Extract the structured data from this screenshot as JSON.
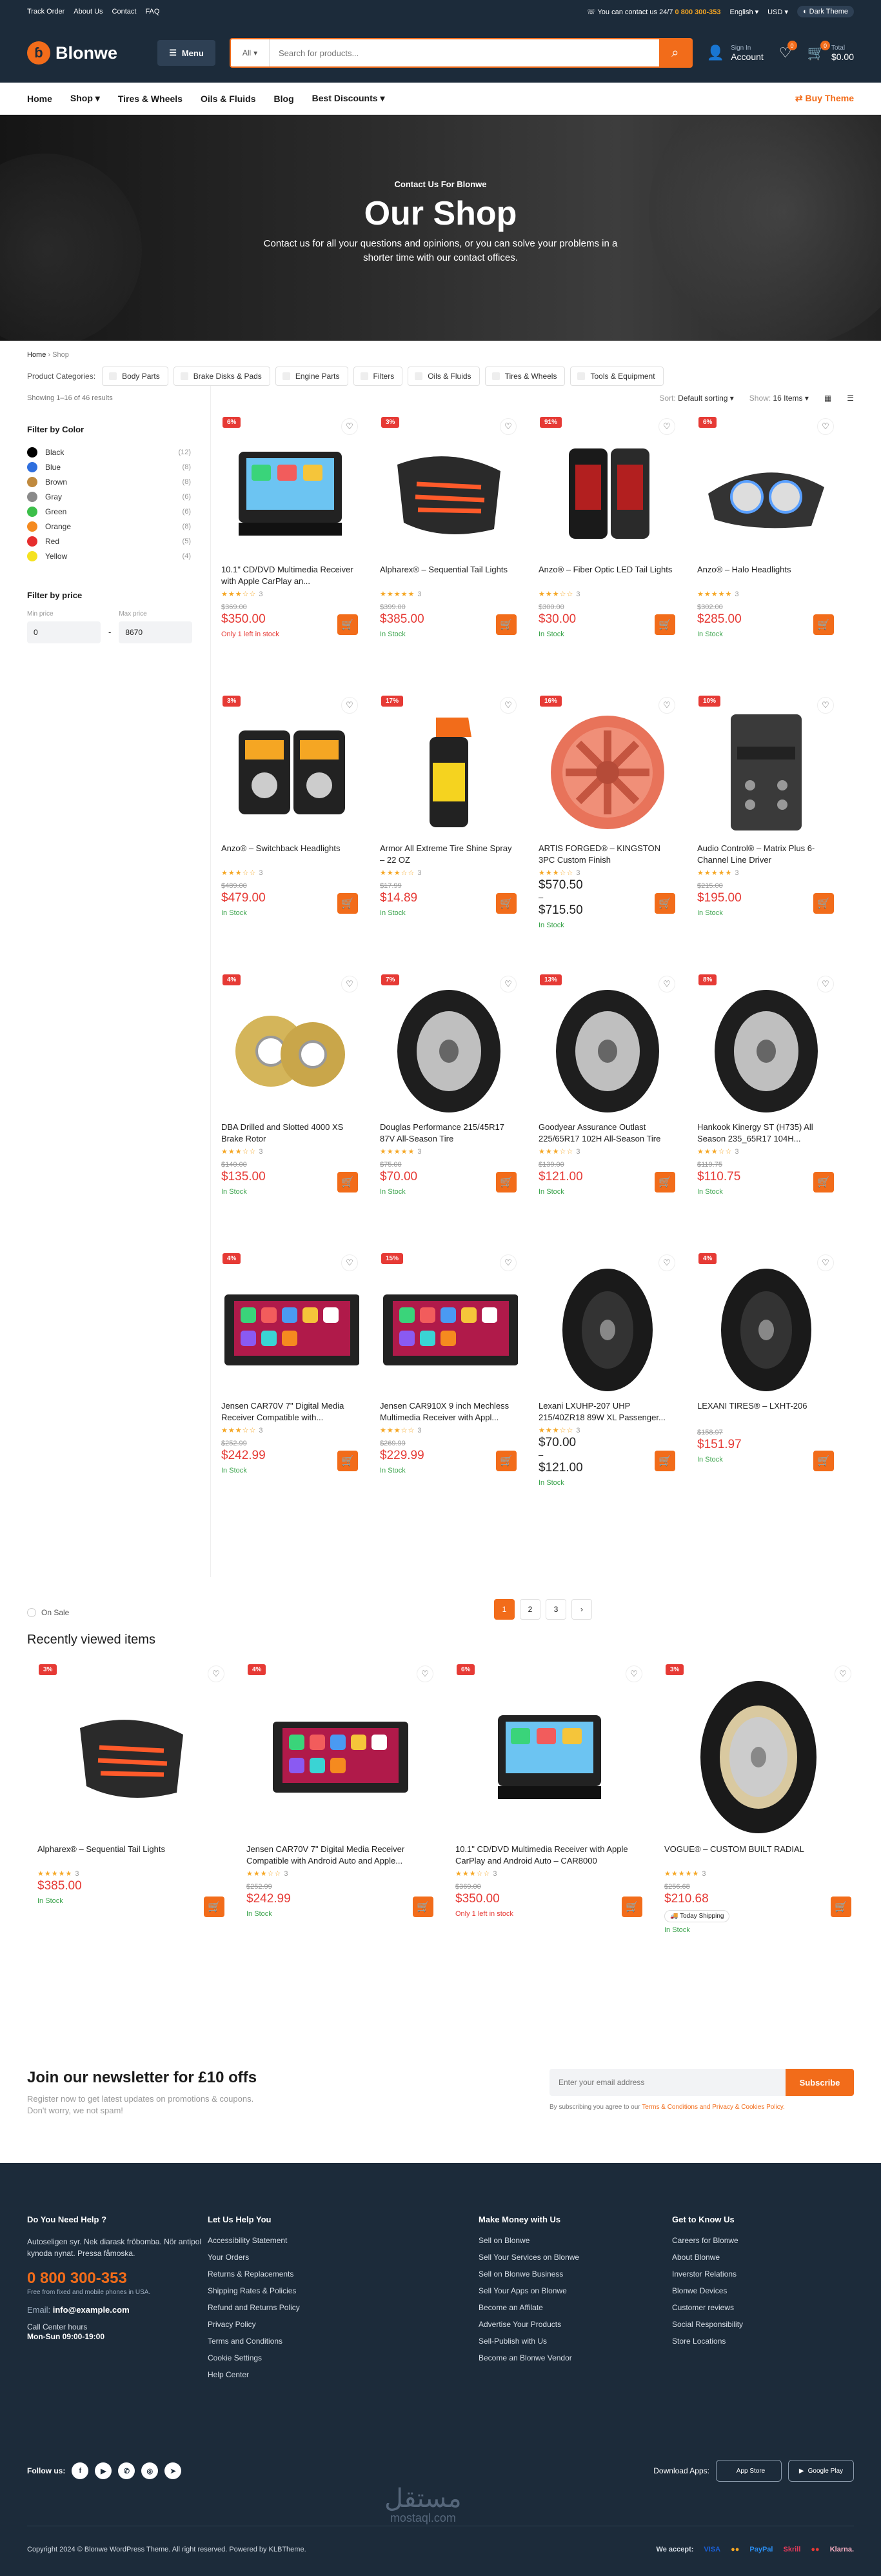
{
  "topbar": {
    "links": [
      "Track Order",
      "About Us",
      "Contact",
      "FAQ"
    ],
    "support": "You can contact us 24/7",
    "phone": "0 800 300-353",
    "lang": "English",
    "currency": "USD",
    "theme": "Dark Theme"
  },
  "header": {
    "logo": "Blonwe",
    "menu": "Menu",
    "search_cat": "All",
    "search_placeholder": "Search for products...",
    "signin": "Sign In",
    "account": "Account",
    "wish_count": "0",
    "cart_count": "0",
    "total_label": "Total",
    "total": "$0.00"
  },
  "nav": {
    "items": [
      "Home",
      "Shop",
      "Tires & Wheels",
      "Oils & Fluids",
      "Blog",
      "Best Discounts"
    ],
    "buy": "Buy Theme"
  },
  "hero": {
    "eyebrow": "Contact Us For Blonwe",
    "title": "Our Shop",
    "text": "Contact us for all your questions and opinions, or you can solve your problems in a shorter time with our contact offices."
  },
  "breadcrumb": {
    "home": "Home",
    "current": "Shop"
  },
  "categories": {
    "label": "Product Categories:",
    "items": [
      "Body Parts",
      "Brake Disks & Pads",
      "Engine Parts",
      "Filters",
      "Oils & Fluids",
      "Tires & Wheels",
      "Tools & Equipment"
    ]
  },
  "results": "Showing 1–16 of 46 results",
  "sort": {
    "label": "Sort:",
    "value": "Default sorting",
    "show_label": "Show:",
    "show_value": "16 Items"
  },
  "filters": {
    "color_title": "Filter by Color",
    "colors": [
      {
        "name": "Black",
        "count": "(12)",
        "hex": "#000000"
      },
      {
        "name": "Blue",
        "count": "(8)",
        "hex": "#2f6fde"
      },
      {
        "name": "Brown",
        "count": "(8)",
        "hex": "#c08a3e"
      },
      {
        "name": "Gray",
        "count": "(6)",
        "hex": "#8a8a8a"
      },
      {
        "name": "Green",
        "count": "(6)",
        "hex": "#3cbf4a"
      },
      {
        "name": "Orange",
        "count": "(8)",
        "hex": "#f58a1f"
      },
      {
        "name": "Red",
        "count": "(5)",
        "hex": "#e62e2e"
      },
      {
        "name": "Yellow",
        "count": "(4)",
        "hex": "#f5e21f"
      }
    ],
    "price_title": "Filter by price",
    "min_label": "Min price",
    "min": "0",
    "max_label": "Max price",
    "max": "8670"
  },
  "products": [
    {
      "disc": "6%",
      "title": "10.1\" CD/DVD Multimedia Receiver with Apple CarPlay an...",
      "stars": 3,
      "reviews": "3",
      "old": "$369.00",
      "price": "$350.00",
      "stock": "Only 1 left in stock",
      "low": true,
      "img": "stereo"
    },
    {
      "disc": "3%",
      "title": "Alpharex® – Sequential Tail Lights",
      "stars": 5,
      "reviews": "3",
      "old": "$399.00",
      "price": "$385.00",
      "stock": "In Stock",
      "img": "tail"
    },
    {
      "disc": "91%",
      "title": "Anzo® – Fiber Optic LED Tail Lights",
      "stars": 3,
      "reviews": "3",
      "old": "$300.00",
      "price": "$30.00",
      "stock": "In Stock",
      "img": "tail2"
    },
    {
      "disc": "6%",
      "title": "Anzo® – Halo Headlights",
      "stars": 5,
      "reviews": "3",
      "old": "$302.00",
      "price": "$285.00",
      "stock": "In Stock",
      "img": "head"
    },
    {
      "disc": "3%",
      "title": "Anzo® – Switchback Headlights",
      "stars": 3,
      "reviews": "3",
      "old": "$489.00",
      "price": "$479.00",
      "stock": "In Stock",
      "img": "head2"
    },
    {
      "disc": "17%",
      "title": "Armor All Extreme Tire Shine Spray – 22 OZ",
      "stars": 3,
      "reviews": "3",
      "old": "$17.99",
      "price": "$14.89",
      "stock": "In Stock",
      "img": "spray"
    },
    {
      "disc": "16%",
      "title": "ARTIS FORGED® – KINGSTON 3PC Custom Finish",
      "stars": 3,
      "reviews": "3",
      "old": "",
      "price": "$570.50",
      "price2": "$715.50",
      "stock": "In Stock",
      "img": "rim"
    },
    {
      "disc": "10%",
      "title": "Audio Control® – Matrix Plus 6-Channel Line Driver",
      "stars": 5,
      "reviews": "3",
      "old": "$215.00",
      "price": "$195.00",
      "stock": "In Stock",
      "img": "amp"
    },
    {
      "disc": "4%",
      "title": "DBA Drilled and Slotted 4000 XS Brake Rotor",
      "stars": 3,
      "reviews": "3",
      "old": "$140.00",
      "price": "$135.00",
      "stock": "In Stock",
      "img": "rotor"
    },
    {
      "disc": "7%",
      "title": "Douglas Performance 215/45R17 87V All-Season Tire",
      "stars": 5,
      "reviews": "3",
      "old": "$75.00",
      "price": "$70.00",
      "stock": "In Stock",
      "img": "tire"
    },
    {
      "disc": "13%",
      "title": "Goodyear Assurance Outlast 225/65R17 102H All-Season Tire",
      "stars": 3,
      "reviews": "3",
      "old": "$139.00",
      "price": "$121.00",
      "stock": "In Stock",
      "img": "tire"
    },
    {
      "disc": "8%",
      "title": "Hankook Kinergy ST (H735) All Season 235_65R17 104H...",
      "stars": 3,
      "reviews": "3",
      "old": "$119.75",
      "price": "$110.75",
      "stock": "In Stock",
      "img": "tire"
    },
    {
      "disc": "4%",
      "title": "Jensen CAR70V 7\" Digital Media Receiver Compatible with...",
      "stars": 3,
      "reviews": "3",
      "old": "$252.99",
      "price": "$242.99",
      "stock": "In Stock",
      "img": "carplay"
    },
    {
      "disc": "15%",
      "title": "Jensen CAR910X 9 inch Mechless Multimedia Receiver with Appl...",
      "stars": 3,
      "reviews": "3",
      "old": "$269.99",
      "price": "$229.99",
      "stock": "In Stock",
      "img": "carplay"
    },
    {
      "disc": "",
      "title": "Lexani LXUHP-207 UHP 215/40ZR18 89W XL Passenger...",
      "stars": 3,
      "reviews": "3",
      "old": "",
      "price": "$70.00",
      "price2": "$121.00",
      "stock": "In Stock",
      "img": "tire2"
    },
    {
      "disc": "4%",
      "title": "LEXANI TIRES® – LXHT-206",
      "stars": 0,
      "reviews": "",
      "old": "$158.97",
      "price": "$151.97",
      "stock": "In Stock",
      "img": "tire2"
    }
  ],
  "sale_label": "On Sale",
  "pagination": [
    "1",
    "2",
    "3",
    "›"
  ],
  "recent": {
    "title": "Recently viewed items",
    "items": [
      {
        "disc": "3%",
        "title": "Alpharex® – Sequential Tail Lights",
        "stars": 5,
        "reviews": "3",
        "old": "",
        "price": "$385.00",
        "stock": "In Stock",
        "img": "tail"
      },
      {
        "disc": "4%",
        "title": "Jensen CAR70V 7\" Digital Media Receiver Compatible with Android Auto and Apple...",
        "stars": 3,
        "reviews": "3",
        "old": "$252.99",
        "price": "$242.99",
        "stock": "In Stock",
        "img": "carplay"
      },
      {
        "disc": "6%",
        "title": "10.1\" CD/DVD Multimedia Receiver with Apple CarPlay and Android Auto – CAR8000",
        "stars": 3,
        "reviews": "3",
        "old": "$369.00",
        "price": "$350.00",
        "stock": "Only 1 left in stock",
        "low": true,
        "img": "stereo"
      },
      {
        "disc": "3%",
        "title": "VOGUE® – CUSTOM BUILT RADIAL",
        "stars": 5,
        "reviews": "3",
        "old": "$256.68",
        "price": "$210.68",
        "stock": "In Stock",
        "ship": "Today Shipping",
        "img": "tire3"
      }
    ]
  },
  "newsletter": {
    "title": "Join our newsletter for £10 offs",
    "text1": "Register now to get latest updates on promotions & coupons.",
    "text2": "Don't worry, we not spam!",
    "placeholder": "Enter your email address",
    "button": "Subscribe",
    "note": "By subscribing you agree to our",
    "terms": "Terms & Conditions and Privacy & Cookies Policy."
  },
  "footer": {
    "help": {
      "title": "Do You Need Help ?",
      "text": "Autoseligen syr. Nek diarask fröbomba. Nör antipol kynoda nynat. Pressa fåmoska.",
      "phone": "0 800 300-353",
      "phone_note": "Free from fixed and mobile phones in USA.",
      "email_label": "Email:",
      "email": "info@example.com",
      "cc": "Call Center hours",
      "hours": "Mon-Sun 09:00-19:00"
    },
    "cols": [
      {
        "title": "Let Us Help You",
        "items": [
          "Accessibility Statement",
          "Your Orders",
          "Returns & Replacements",
          "Shipping Rates & Policies",
          "Refund and Returns Policy",
          "Privacy Policy",
          "Terms and Conditions",
          "Cookie Settings",
          "Help Center"
        ]
      },
      {
        "title": "Make Money with Us",
        "items": [
          "Sell on Blonwe",
          "Sell Your Services on Blonwe",
          "Sell on Blonwe Business",
          "Sell Your Apps on Blonwe",
          "Become an Affilate",
          "Advertise Your Products",
          "Sell-Publish with Us",
          "Become an Blonwe Vendor"
        ]
      },
      {
        "title": "Get to Know Us",
        "items": [
          "Careers for Blonwe",
          "About Blonwe",
          "Inverstor Relations",
          "Blonwe Devices",
          "Customer reviews",
          "Social Responsibility",
          "Store Locations"
        ]
      }
    ],
    "follow": "Follow us:",
    "download": "Download Apps:",
    "appstore": "App Store",
    "googleplay": "Google Play",
    "copyright": "Copyright 2024 © Blonwe WordPress Theme. All right reserved. Powered by KLBTheme.",
    "accept": "We accept:",
    "pay": [
      "VISA",
      "●●",
      "PayPal",
      "Skrill",
      "●●",
      "Klarna."
    ],
    "watermark": "مستقل",
    "watermark2": "mostaql.com"
  }
}
